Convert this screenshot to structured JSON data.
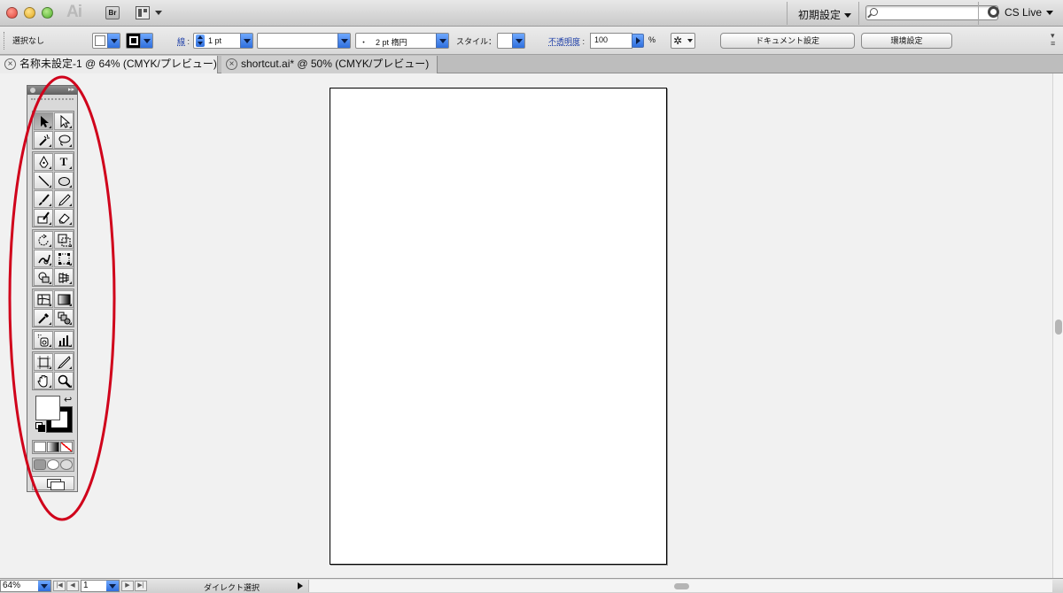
{
  "titlebar": {
    "app_logo": "Ai",
    "bridge_label": "Br",
    "workspace": "初期設定",
    "search_placeholder": "",
    "cs_live": "CS Live"
  },
  "controlbar": {
    "selection_status": "選択なし",
    "stroke_label": "線",
    "colon": ":",
    "stroke_weight": "1 pt",
    "variable_width": "",
    "brush": "・　2 pt 楕円",
    "style_label": "スタイル：",
    "opacity_label": "不透明度",
    "opacity_value": "100",
    "percent": "%",
    "document_setup": "ドキュメント設定",
    "preferences": "環境設定"
  },
  "tabs": [
    {
      "label": "名称未設定-1 @ 64% (CMYK/プレビュー)",
      "active": true
    },
    {
      "label": "shortcut.ai* @ 50% (CMYK/プレビュー)",
      "active": false
    }
  ],
  "toolbox": {
    "type_tool_glyph": "T",
    "swap_glyph": "↩"
  },
  "statusbar": {
    "zoom": "64%",
    "page": "1",
    "current_tool": "ダイレクト選択"
  },
  "colors": {
    "annotation": "#d0021b",
    "accent_blue": "#2f6fdc",
    "artboard": "#ffffff",
    "canvas": "#f1f1f1"
  }
}
